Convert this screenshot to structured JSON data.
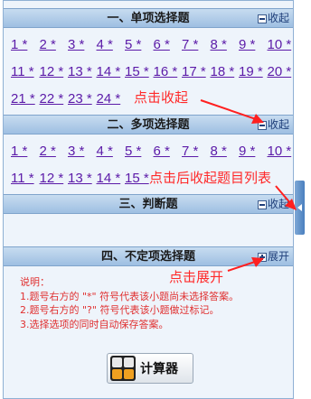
{
  "sections": [
    {
      "title": "一、单项选择题",
      "toggle": "收起",
      "icon": "minus-box-icon"
    },
    {
      "title": "二、多项选择题",
      "toggle": "收起",
      "icon": "minus-box-icon"
    },
    {
      "title": "三、判断题",
      "toggle": "收起",
      "icon": "minus-box-icon"
    },
    {
      "title": "四、不定项选择题",
      "toggle": "展开",
      "icon": "plus-box-icon"
    }
  ],
  "single_choice": {
    "row1": [
      "1 *",
      "2 *",
      "3 *",
      "4 *",
      "5 *",
      "6 *",
      "7 *",
      "8 *",
      "9 *",
      "10 *"
    ],
    "row2": [
      "11 *",
      "12 *",
      "13 *",
      "14 *",
      "15 *",
      "16 *",
      "17 *",
      "18 *",
      "19 *",
      "20 *"
    ],
    "row3": [
      "21 *",
      "22 *",
      "23 *",
      "24 *"
    ]
  },
  "multi_choice": {
    "row1": [
      "1 *",
      "2 *",
      "3 *",
      "4 *",
      "5 *",
      "6 *",
      "7 *",
      "8 *",
      "9 *",
      "10 *"
    ],
    "row2": [
      "11 *",
      "12 *",
      "13 *",
      "14 *",
      "15 *"
    ]
  },
  "annotations": {
    "collapse": "点击收起",
    "collapsed_list": "点击后收起题目列表",
    "expand": "点击展开"
  },
  "notes": {
    "heading": "说明：",
    "line1": "1.题号右方的 \"*\" 符号代表该小题尚未选择答案。",
    "line2": "2.题号右方的 \"?\" 符号代表该小题做过标记。",
    "line3": "3.选择选项的同时自动保存答案。"
  },
  "calculator": {
    "label": "计算器",
    "icon": "calculator-icon"
  },
  "colors": {
    "annotation": "#ff2a2a",
    "question_link": "#5b1aa8",
    "arrow": "#ff2020"
  }
}
